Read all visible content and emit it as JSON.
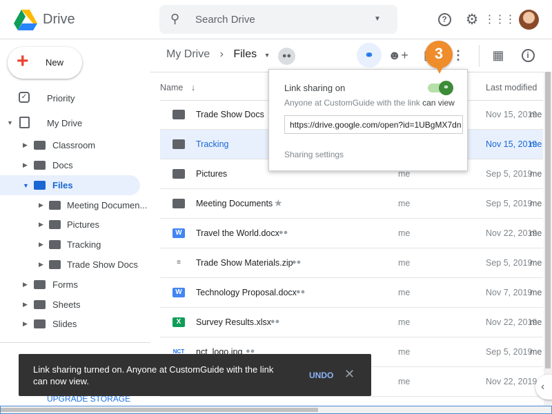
{
  "app": {
    "title": "Drive"
  },
  "search": {
    "placeholder": "Search Drive"
  },
  "header_icons": [
    "help-icon",
    "settings-icon",
    "apps-icon",
    "avatar"
  ],
  "new_button": "New",
  "sidebar": {
    "items": [
      {
        "label": "Priority",
        "level": 0
      },
      {
        "label": "My Drive",
        "level": 0,
        "expanded": true
      },
      {
        "label": "Classroom",
        "level": 1
      },
      {
        "label": "Docs",
        "level": 1
      },
      {
        "label": "Files",
        "level": 1,
        "expanded": true,
        "selected": true
      },
      {
        "label": "Meeting Documen...",
        "level": 2
      },
      {
        "label": "Pictures",
        "level": 2
      },
      {
        "label": "Tracking",
        "level": 2
      },
      {
        "label": "Trade Show Docs",
        "level": 2
      },
      {
        "label": "Forms",
        "level": 1
      },
      {
        "label": "Sheets",
        "level": 1
      },
      {
        "label": "Slides",
        "level": 1
      }
    ],
    "upgrade": "UPGRADE STORAGE"
  },
  "breadcrumb": {
    "root": "My Drive",
    "current": "Files"
  },
  "columns": {
    "name": "Name",
    "modified": "Last modified"
  },
  "files": [
    {
      "name": "Trade Show Docs",
      "type": "folder",
      "owner": "",
      "date": "Nov 15, 2019",
      "by": "me"
    },
    {
      "name": "Tracking",
      "type": "shared-folder",
      "owner": "",
      "date": "Nov 15, 2019",
      "by": "me",
      "selected": true
    },
    {
      "name": "Pictures",
      "type": "shared-folder",
      "owner": "me",
      "date": "Sep 5, 2019",
      "by": "me"
    },
    {
      "name": "Meeting Documents",
      "type": "shared-folder",
      "owner": "me",
      "date": "Sep 5, 2019",
      "by": "me",
      "starred": true
    },
    {
      "name": "Travel the World.docx",
      "type": "doc",
      "owner": "me",
      "date": "Nov 22, 2019",
      "by": "me",
      "shared": true
    },
    {
      "name": "Trade Show Materials.zip",
      "type": "zip",
      "owner": "me",
      "date": "Sep 5, 2019",
      "by": "me",
      "shared": true
    },
    {
      "name": "Technology Proposal.docx",
      "type": "doc",
      "owner": "me",
      "date": "Nov 7, 2019",
      "by": "me",
      "shared": true
    },
    {
      "name": "Survey Results.xlsx",
      "type": "sheet",
      "owner": "me",
      "date": "Nov 22, 2019",
      "by": "me",
      "shared": true
    },
    {
      "name": "nct_logo.jpg",
      "type": "image",
      "owner": "me",
      "date": "Sep 5, 2019",
      "by": "me",
      "shared": true
    },
    {
      "name": "",
      "type": "",
      "owner": "me",
      "date": "Nov 22, 2019",
      "by": ""
    }
  ],
  "popup": {
    "title": "Link sharing on",
    "desc_prefix": "Anyone at CustomGuide with the link",
    "desc_access": "can view",
    "url": "https://drive.google.com/open?id=1UBgMX7dn",
    "settings": "Sharing settings",
    "toggle_on": true
  },
  "callout": "3",
  "toast": {
    "message": "Link sharing turned on. Anyone at CustomGuide with the link can now view.",
    "undo": "UNDO"
  },
  "colors": {
    "accent": "#1a73e8",
    "toggle": "#3d8b37",
    "callout": "#ef8c2b",
    "toast": "#323232"
  }
}
